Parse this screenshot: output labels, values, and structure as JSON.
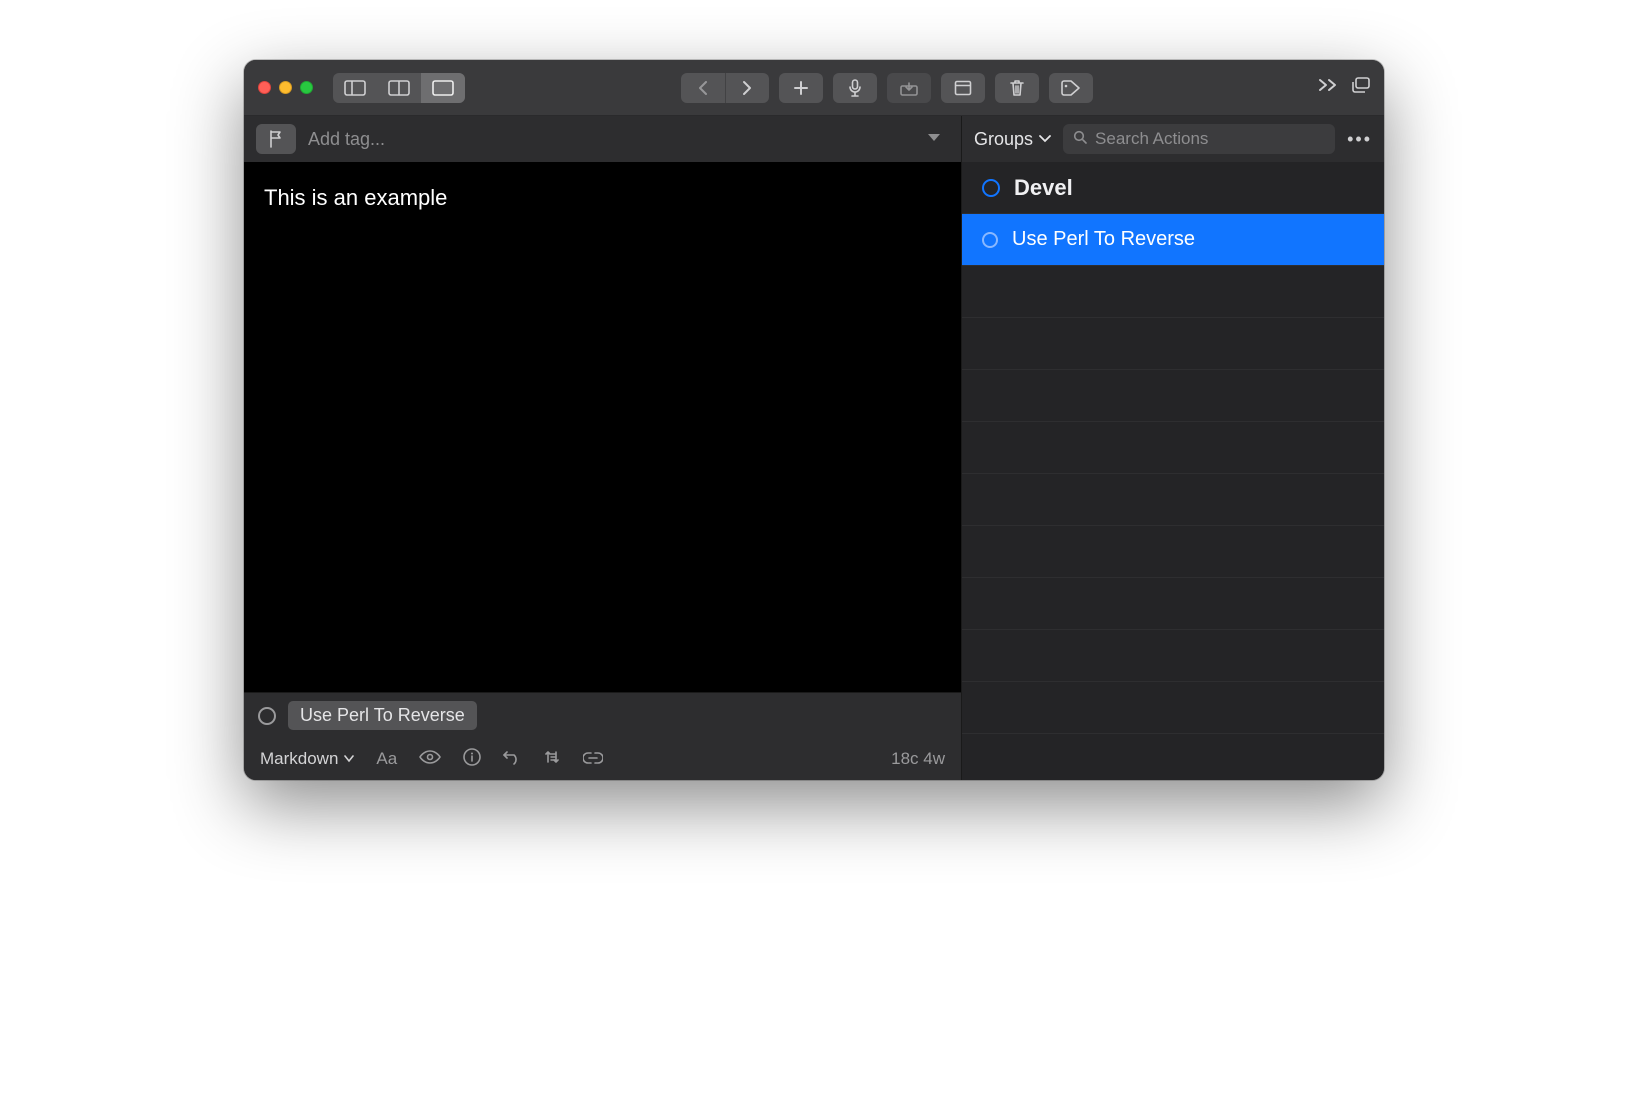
{
  "tagbar": {
    "placeholder": "Add tag..."
  },
  "editor": {
    "content": "This is an example"
  },
  "action_strip": {
    "pending_action": "Use Perl To Reverse"
  },
  "statusbar": {
    "mode": "Markdown",
    "counts": "18c 4w"
  },
  "sidebar": {
    "groups_label": "Groups",
    "search_placeholder": "Search Actions",
    "group": "Devel",
    "actions": [
      {
        "label": "Use Perl To Reverse",
        "selected": true
      }
    ],
    "empty_rows": 9
  }
}
